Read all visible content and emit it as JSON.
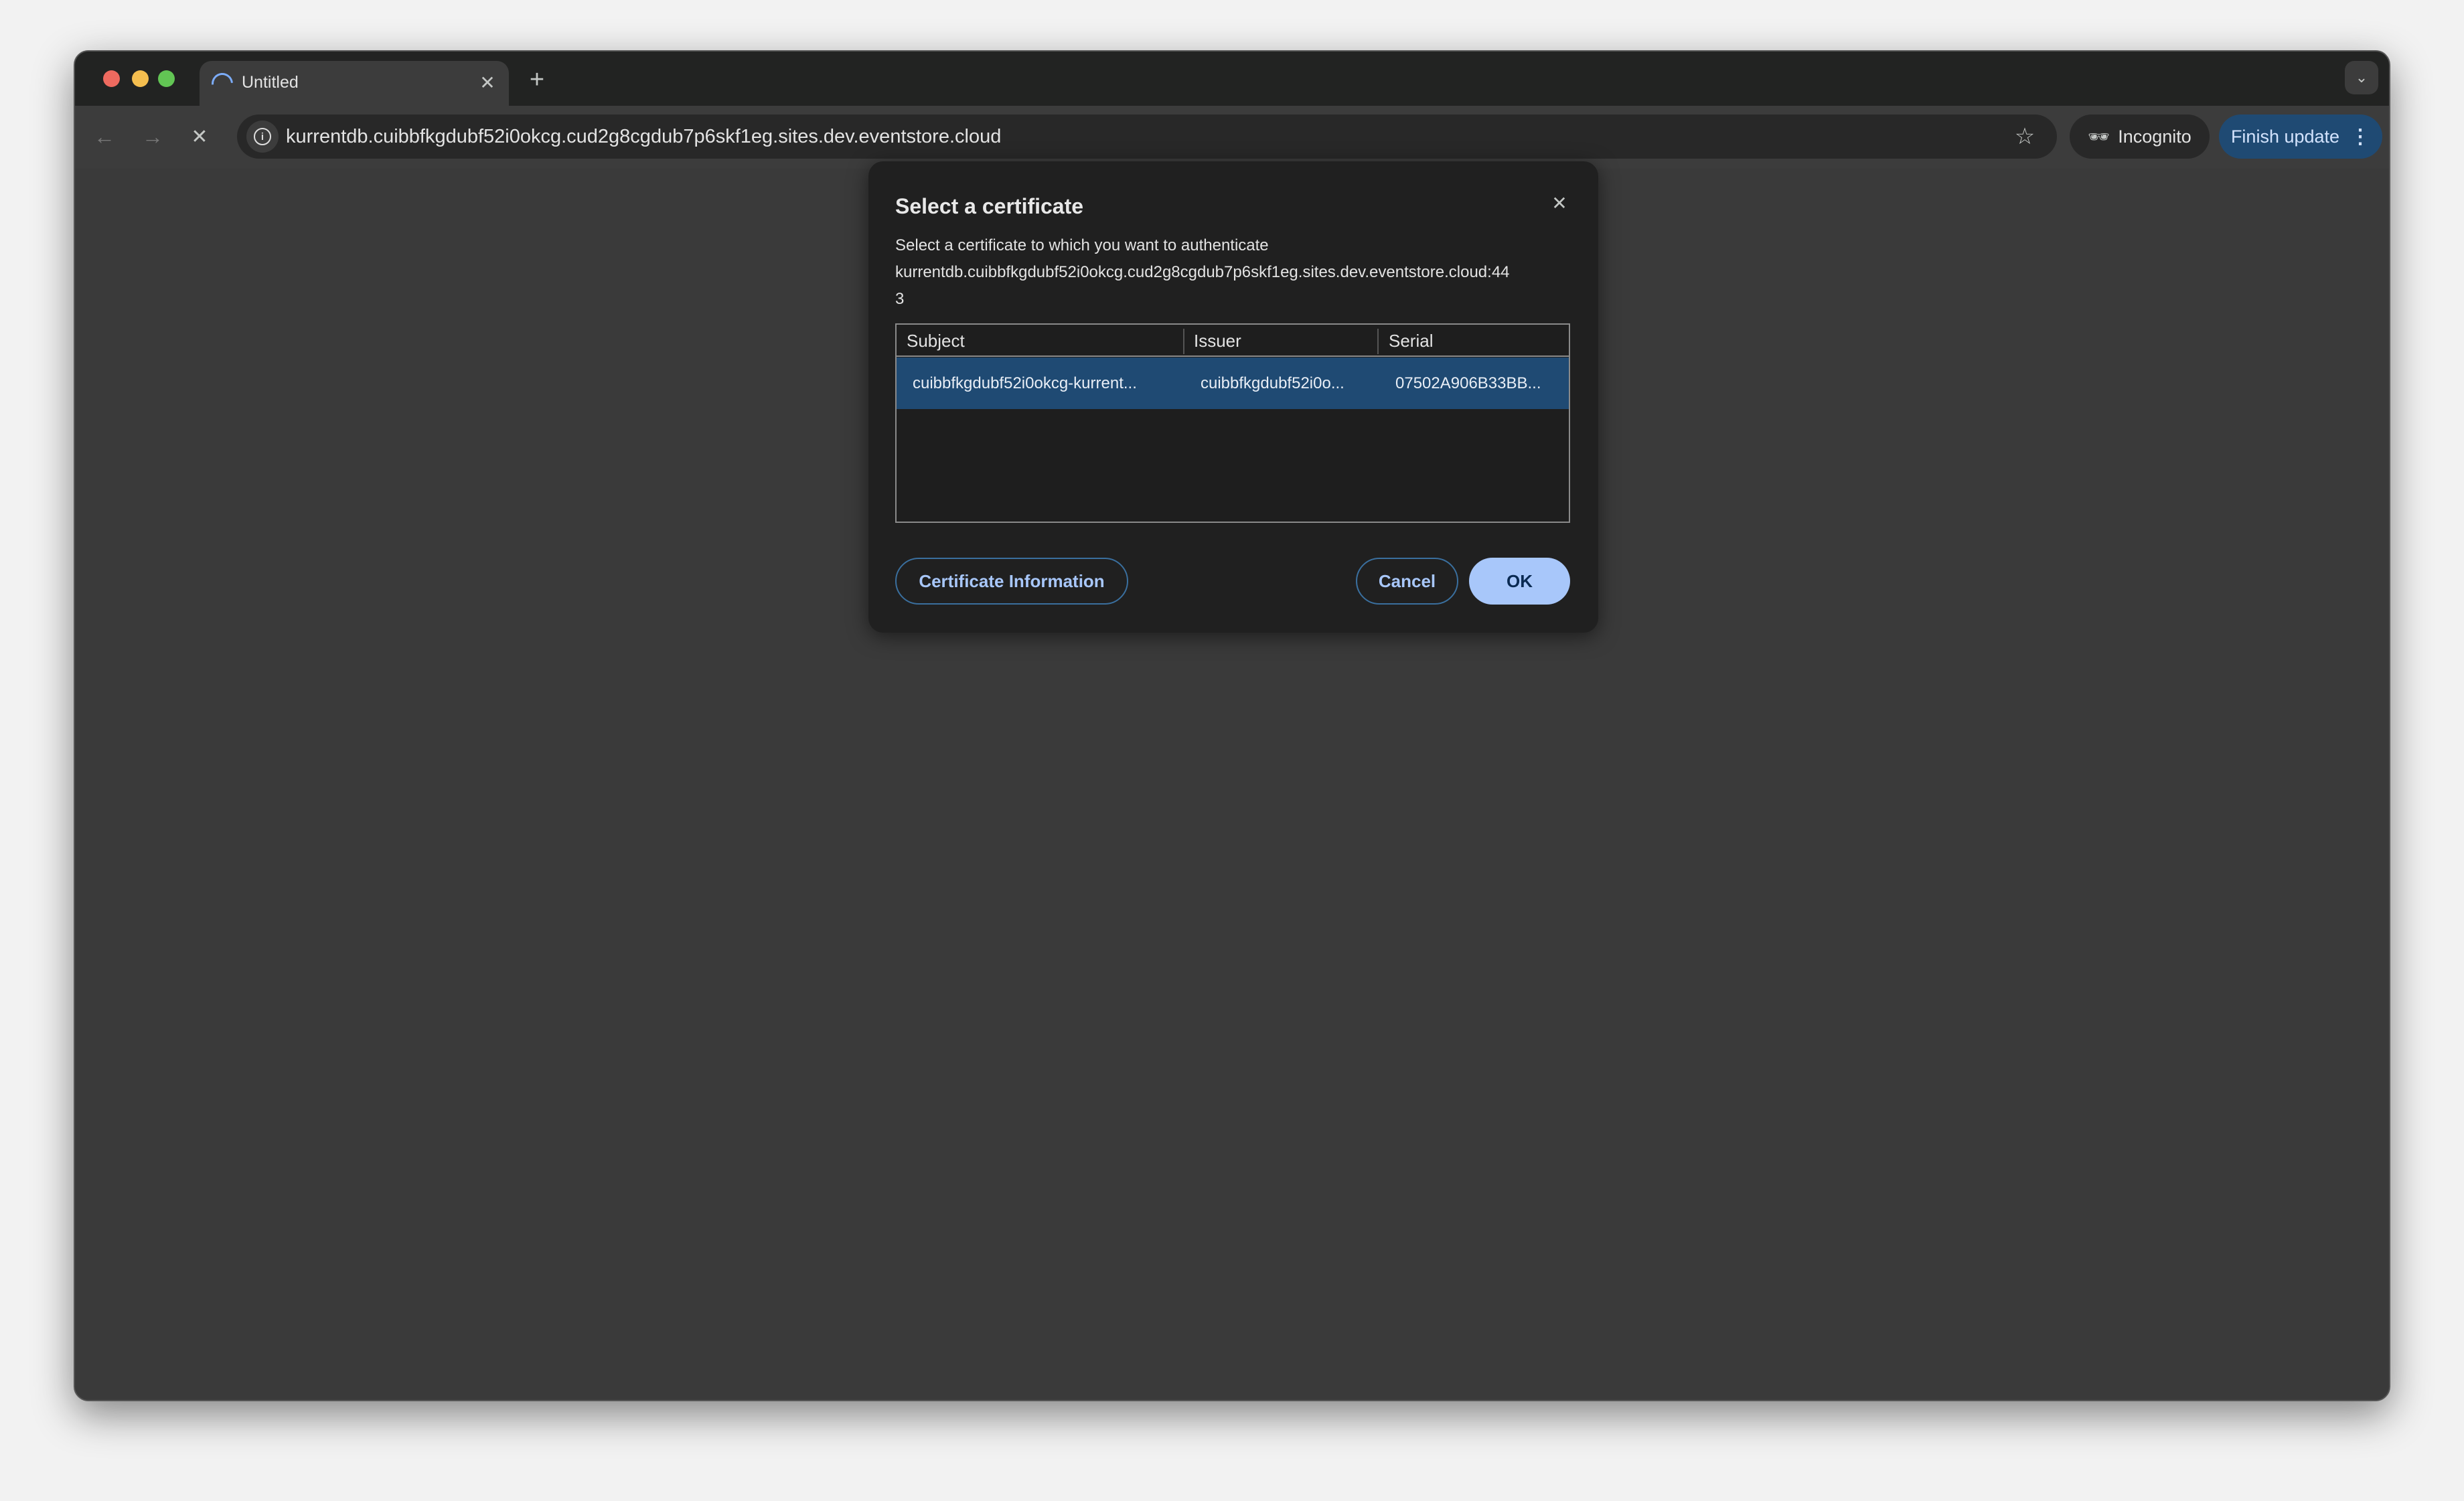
{
  "browser": {
    "tab": {
      "title": "Untitled",
      "loading": true
    },
    "new_tab_icon": "plus-icon",
    "url": "kurrentdb.cuibbfkgdubf52i0okcg.cud2g8cgdub7p6skf1eg.sites.dev.eventstore.cloud",
    "incognito_label": "Incognito",
    "finish_update_label": "Finish update",
    "colors": {
      "accent": "#1f4a73",
      "progress": "#7cacf8"
    }
  },
  "dialog": {
    "title": "Select a certificate",
    "description": "Select a certificate to which you want to authenticate",
    "host_line1": "kurrentdb.cuibbfkgdubf52i0okcg.cud2g8cgdub7p6skf1eg.sites.dev.eventstore.cloud:44",
    "host_line2": "3",
    "columns": [
      "Subject",
      "Issuer",
      "Serial"
    ],
    "rows": [
      {
        "subject": "cuibbfkgdubf52i0okcg-kurrent...",
        "issuer": "cuibbfkgdubf52i0o...",
        "serial": "07502A906B33BB...",
        "selected": true
      }
    ],
    "cert_info_label": "Certificate Information",
    "cancel_label": "Cancel",
    "ok_label": "OK"
  }
}
